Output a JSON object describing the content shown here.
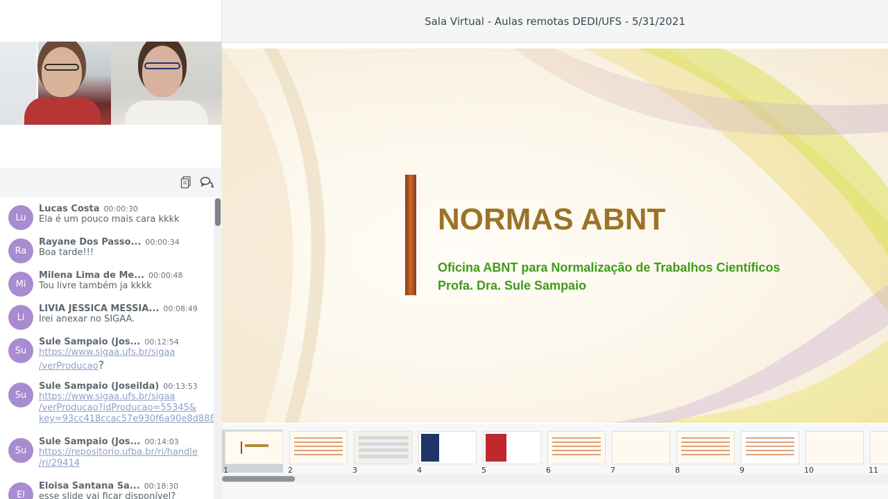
{
  "session": {
    "title": "Sala Virtual - Aulas remotas DEDI/UFS - 5/31/2021"
  },
  "participants": [
    {
      "name": "participant-1"
    },
    {
      "name": "participant-2"
    }
  ],
  "chat_toolbar": {
    "copy_icon": "copy-icon",
    "chat_icon": "chat-bubbles-icon"
  },
  "chat": {
    "avatar_color": "#a98ccf",
    "messages": [
      {
        "initials": "Lu",
        "author": "Lucas Costa",
        "time": "00:00:30",
        "lines": [
          "Ela é um pouco mais cara kkkk"
        ],
        "links": []
      },
      {
        "initials": "Ra",
        "author": "Rayane Dos Passo...",
        "time": "00:00:34",
        "lines": [
          "Boa tarde!!!"
        ],
        "links": []
      },
      {
        "initials": "Mi",
        "author": "Milena Lima de Me...",
        "time": "00:00:48",
        "lines": [
          "Tou livre também ja kkkk"
        ],
        "links": []
      },
      {
        "initials": "Li",
        "author": "LIVIA JESSICA MESSIA...",
        "time": "00:08:49",
        "lines": [
          "Irei anexar no SIGAA."
        ],
        "links": []
      },
      {
        "initials": "Su",
        "author": "Sule Sampaio (Jos...",
        "time": "00:12:54",
        "lines": [],
        "links": [
          "https://www.sigaa.ufs.br/sigaa",
          "/verProducao"
        ],
        "suffix": "?"
      },
      {
        "initials": "Su",
        "author": "Sule Sampaio (Joseilda)",
        "time": "00:13:53",
        "lines": [],
        "links": [
          "https://www.sigaa.ufs.br/sigaa",
          "/verProducao?idProducao=55345&",
          "key=93cc418ccac57e930f6a90e8d888"
        ]
      },
      {
        "initials": "Su",
        "author": "Sule Sampaio (Jos...",
        "time": "00:14:03",
        "lines": [],
        "links": [
          "https://repositorio.ufba.br/ri/handle",
          "/ri/29414"
        ]
      },
      {
        "initials": "El",
        "author": "Eloisa Santana Sa...",
        "time": "00:18:30",
        "lines": [
          "esse slide vai ficar disponível?"
        ],
        "links": []
      }
    ]
  },
  "slide": {
    "title": "NORMAS ABNT",
    "subtitle_line1": "Oficina ABNT para Normalização de Trabalhos Científicos",
    "subtitle_line2": "Profa. Dra. Sule Sampaio",
    "title_color": "#9b7327",
    "subtitle_color": "#3f9a1b"
  },
  "thumbnails": [
    "1",
    "2",
    "3",
    "4",
    "5",
    "6",
    "7",
    "8",
    "9",
    "10",
    "11"
  ],
  "active_slide": "1"
}
